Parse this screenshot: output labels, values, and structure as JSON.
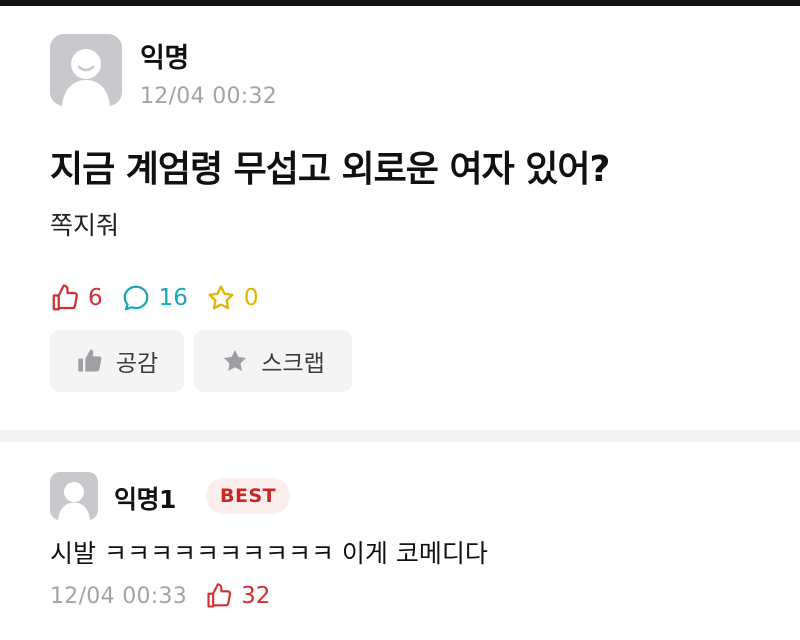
{
  "post": {
    "author": "익명",
    "time": "12/04 00:32",
    "title": "지금 계엄령 무섭고 외로운 여자 있어?",
    "body": "쪽지줘",
    "stats": {
      "likes": "6",
      "comments": "16",
      "scraps": "0"
    },
    "buttons": {
      "empathy": "공감",
      "scrap": "스크랩"
    }
  },
  "comment": {
    "author": "익명1",
    "badge": "BEST",
    "text": "시발 ㅋㅋㅋㅋㅋㅋㅋㅋㅋㅋ 이게 코메디다",
    "time": "12/04 00:33",
    "likes": "32"
  },
  "colors": {
    "like": "#d32f2f",
    "comment": "#1aa7b8",
    "scrap": "#e0b400",
    "avatar": "#c9c9cd",
    "button_bg": "#f4f4f5"
  },
  "icons": {
    "like": "thumbs-up-outline-icon",
    "comment": "speech-bubble-icon",
    "scrap": "star-outline-icon",
    "empathy_button": "thumbs-up-filled-icon",
    "scrap_button": "star-filled-icon",
    "avatar": "anonymous-avatar-icon"
  }
}
